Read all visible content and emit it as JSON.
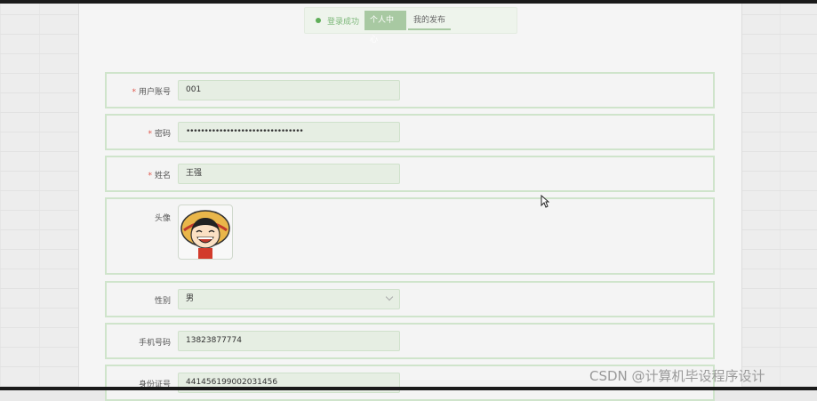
{
  "status": {
    "message": "登录成功"
  },
  "tabs": [
    {
      "label": "个人中心"
    },
    {
      "label": "我的发布"
    }
  ],
  "form": {
    "username": {
      "label": "用户账号",
      "value": "001"
    },
    "password": {
      "label": "密码",
      "value": "••••••••••••••••••••••••••••••••"
    },
    "name": {
      "label": "姓名",
      "value": "王强"
    },
    "avatar": {
      "label": "头像"
    },
    "gender": {
      "label": "性别",
      "value": "男"
    },
    "phone": {
      "label": "手机号码",
      "value": "13823877774"
    },
    "idcard": {
      "label": "身份证号",
      "value": "441456199002031456"
    }
  },
  "watermark": "CSDN @计算机毕设程序设计",
  "colors": {
    "accent": "#a8c9a2",
    "border": "#cfe4cb",
    "required": "#e0564b",
    "success": "#5fae58"
  }
}
